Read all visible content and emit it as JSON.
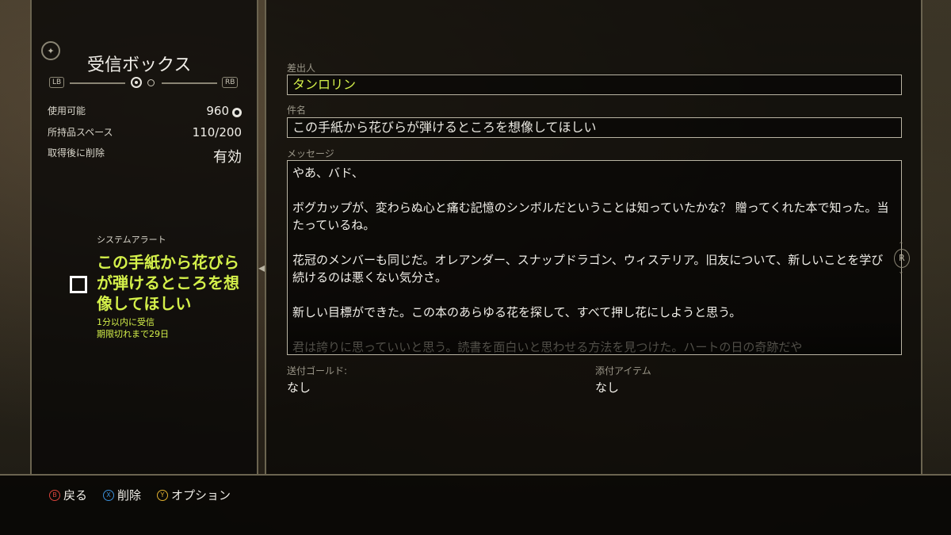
{
  "panel": {
    "title": "受信ボックス",
    "bumper_left": "LB",
    "bumper_right": "RB",
    "stats": [
      {
        "label": "使用可能",
        "value": "960"
      },
      {
        "label": "所持品スペース",
        "value": "110/200"
      },
      {
        "label": "取得後に削除",
        "value": "有効"
      }
    ]
  },
  "alert": {
    "label": "システムアラート",
    "title": "この手紙から花びらが弾けるところを想像してほしい",
    "received": "1分以内に受信",
    "expires": "期限切れまで29日"
  },
  "mail": {
    "from_label": "差出人",
    "from": "タンロリン",
    "subject_label": "件名",
    "subject": "この手紙から花びらが弾けるところを想像してほしい",
    "message_label": "メッセージ",
    "message": [
      "やあ、バド、",
      "ボグカップが、変わらぬ心と痛む記憶のシンボルだということは知っていたかな？ 贈ってくれた本で知った。当たっているね。",
      "花冠のメンバーも同じだ。オレアンダー、スナップドラゴン、ウィステリア。旧友について、新しいことを学び続けるのは悪くない気分さ。",
      "新しい目標ができた。この本のあらゆる花を探して、すべて押し花にしようと思う。",
      "君は誇りに思っていいと思う。読書を面白いと思わせる方法を見つけた。ハートの日の奇跡だや"
    ],
    "gold_label": "送付ゴールド:",
    "gold": "なし",
    "items_label": "添付アイテム",
    "items": "なし",
    "scroll_key": "R"
  },
  "footer": {
    "buttons": [
      {
        "key": "B",
        "label": "戻る",
        "color": "#d9433b"
      },
      {
        "key": "X",
        "label": "削除",
        "color": "#3b8fd9"
      },
      {
        "key": "Y",
        "label": "オプション",
        "color": "#e0b030"
      }
    ]
  },
  "colors": {
    "accent": "#d4f04a",
    "border": "#b9b4a3"
  }
}
